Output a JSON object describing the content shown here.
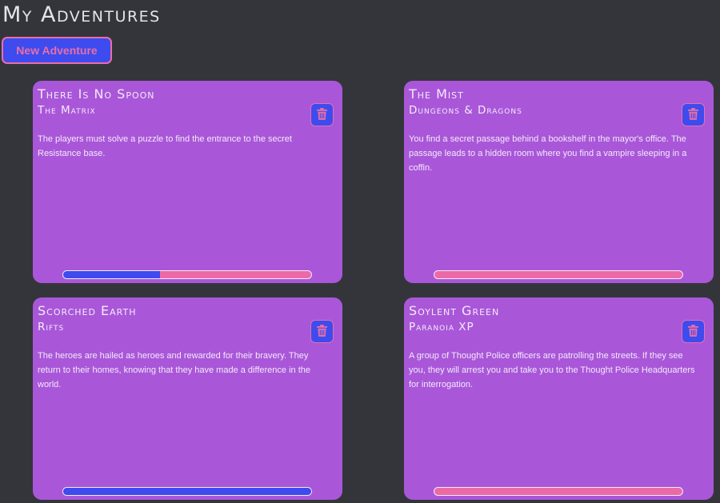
{
  "page": {
    "title": "My Adventures",
    "new_button_label": "New Adventure"
  },
  "colors": {
    "background": "#34353b",
    "card": "#a957d8",
    "accent_blue": "#3d4bef",
    "accent_pink": "#eb6aa6"
  },
  "adventures": [
    {
      "title": "There Is No Spoon",
      "system": "The Matrix",
      "description": "The players must solve a puzzle to find the entrance to the secret Resistance base.",
      "delete_icon": "trash-icon",
      "progress": 0.39
    },
    {
      "title": "The Mist",
      "system": "Dungeons & Dragons",
      "description": "You find a secret passage behind a bookshelf in the mayor's office. The passage leads to a hidden room where you find a vampire sleeping in a coffin.",
      "delete_icon": "trash-icon",
      "progress": 0
    },
    {
      "title": "Scorched Earth",
      "system": "Rifts",
      "description": "The heroes are hailed as heroes and rewarded for their bravery. They return to their homes, knowing that they have made a difference in the world.",
      "delete_icon": "trash-icon",
      "progress": 1
    },
    {
      "title": "Soylent Green",
      "system": "Paranoia XP",
      "description": "A group of Thought Police officers are patrolling the streets. If they see you, they will arrest you and take you to the Thought Police Headquarters for interrogation.",
      "delete_icon": "trash-icon",
      "progress": 0
    }
  ]
}
